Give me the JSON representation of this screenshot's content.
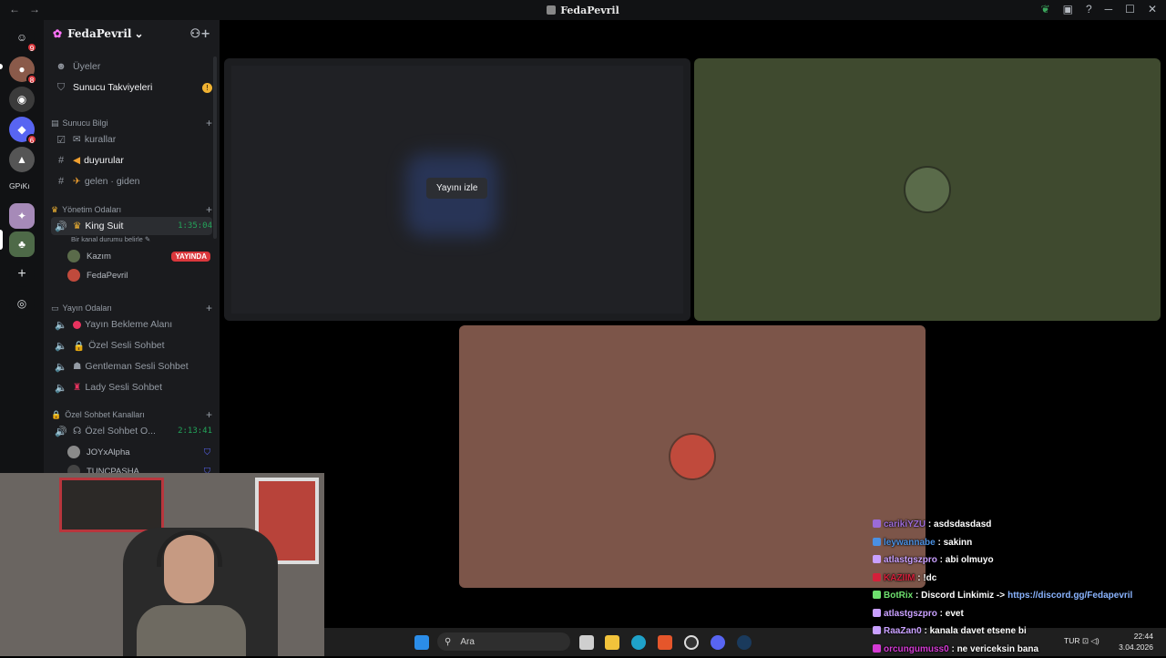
{
  "window": {
    "title": "FedaPevril",
    "nav_back": "←",
    "nav_fwd": "→"
  },
  "rail": {
    "gpik_label": "GPıKı",
    "badges": [
      "9",
      "8",
      "6"
    ]
  },
  "server": {
    "name": "FedaPevril",
    "chevron": "⌄"
  },
  "channels": {
    "uyeler": "Üyeler",
    "takviye": "Sunucu Takviyeleri",
    "cat_bilgi": "Sunucu Bilgi",
    "kurallar": "kurallar",
    "duyurular": "duyurular",
    "gelen_giden": "gelen · giden",
    "cat_yonetim": "Yönetim Odaları",
    "king_suit": "King Suit",
    "king_timer": "1:35:04",
    "status_hint": "Bir kanal durumu belirle",
    "user_kazim": "Kazım",
    "live_label": "YAYINDA",
    "user_feda": "FedaPevril",
    "cat_yayin": "Yayın Odaları",
    "bekleme": "Yayın Bekleme Alanı",
    "ozel_sesli": "Özel Sesli Sohbet",
    "gentleman": "Gentleman Sesli Sohbet",
    "lady": "Lady Sesli Sohbet",
    "cat_ozel": "Özel Sohbet Kanalları",
    "ozel_sohbet": "Özel Sohbet O...",
    "ozel_timer": "2:13:41",
    "user_joy": "JOYxAlpha",
    "user_tunc": "TUNCPASHA"
  },
  "stage": {
    "watch_button": "Yayını izle"
  },
  "taskbar": {
    "search_placeholder": "Ara",
    "lang": "TUR",
    "time": "22:44",
    "date": "3.04.2026"
  },
  "chat": [
    {
      "user": "carikiYZU",
      "text": "asdsdasdasd",
      "color": "#9b6bd6"
    },
    {
      "user": "leywannabe",
      "text": "sakinn",
      "color": "#4a90e2"
    },
    {
      "user": "atlastgszpro",
      "text": "abi olmuyo",
      "color": "#c9a0ff"
    },
    {
      "user": "KAZIIM",
      "text": "!dc",
      "color": "#d4203a"
    },
    {
      "user": "BotRix",
      "text": "Discord Linkimiz ->",
      "link": "https://discord.gg/Fedapevril",
      "color": "#6ee06e"
    },
    {
      "user": "atlastgszpro",
      "text": "evet",
      "color": "#c9a0ff"
    },
    {
      "user": "RaaZan0",
      "text": "kanala davet etsene bi",
      "color": "#c9a0ff"
    },
    {
      "user": "orcungumuss0",
      "text": "ne vericeksin bana",
      "color": "#d43ad4"
    }
  ],
  "colors": {
    "accent_live": "#da373c",
    "voice_green": "#23a55a"
  }
}
